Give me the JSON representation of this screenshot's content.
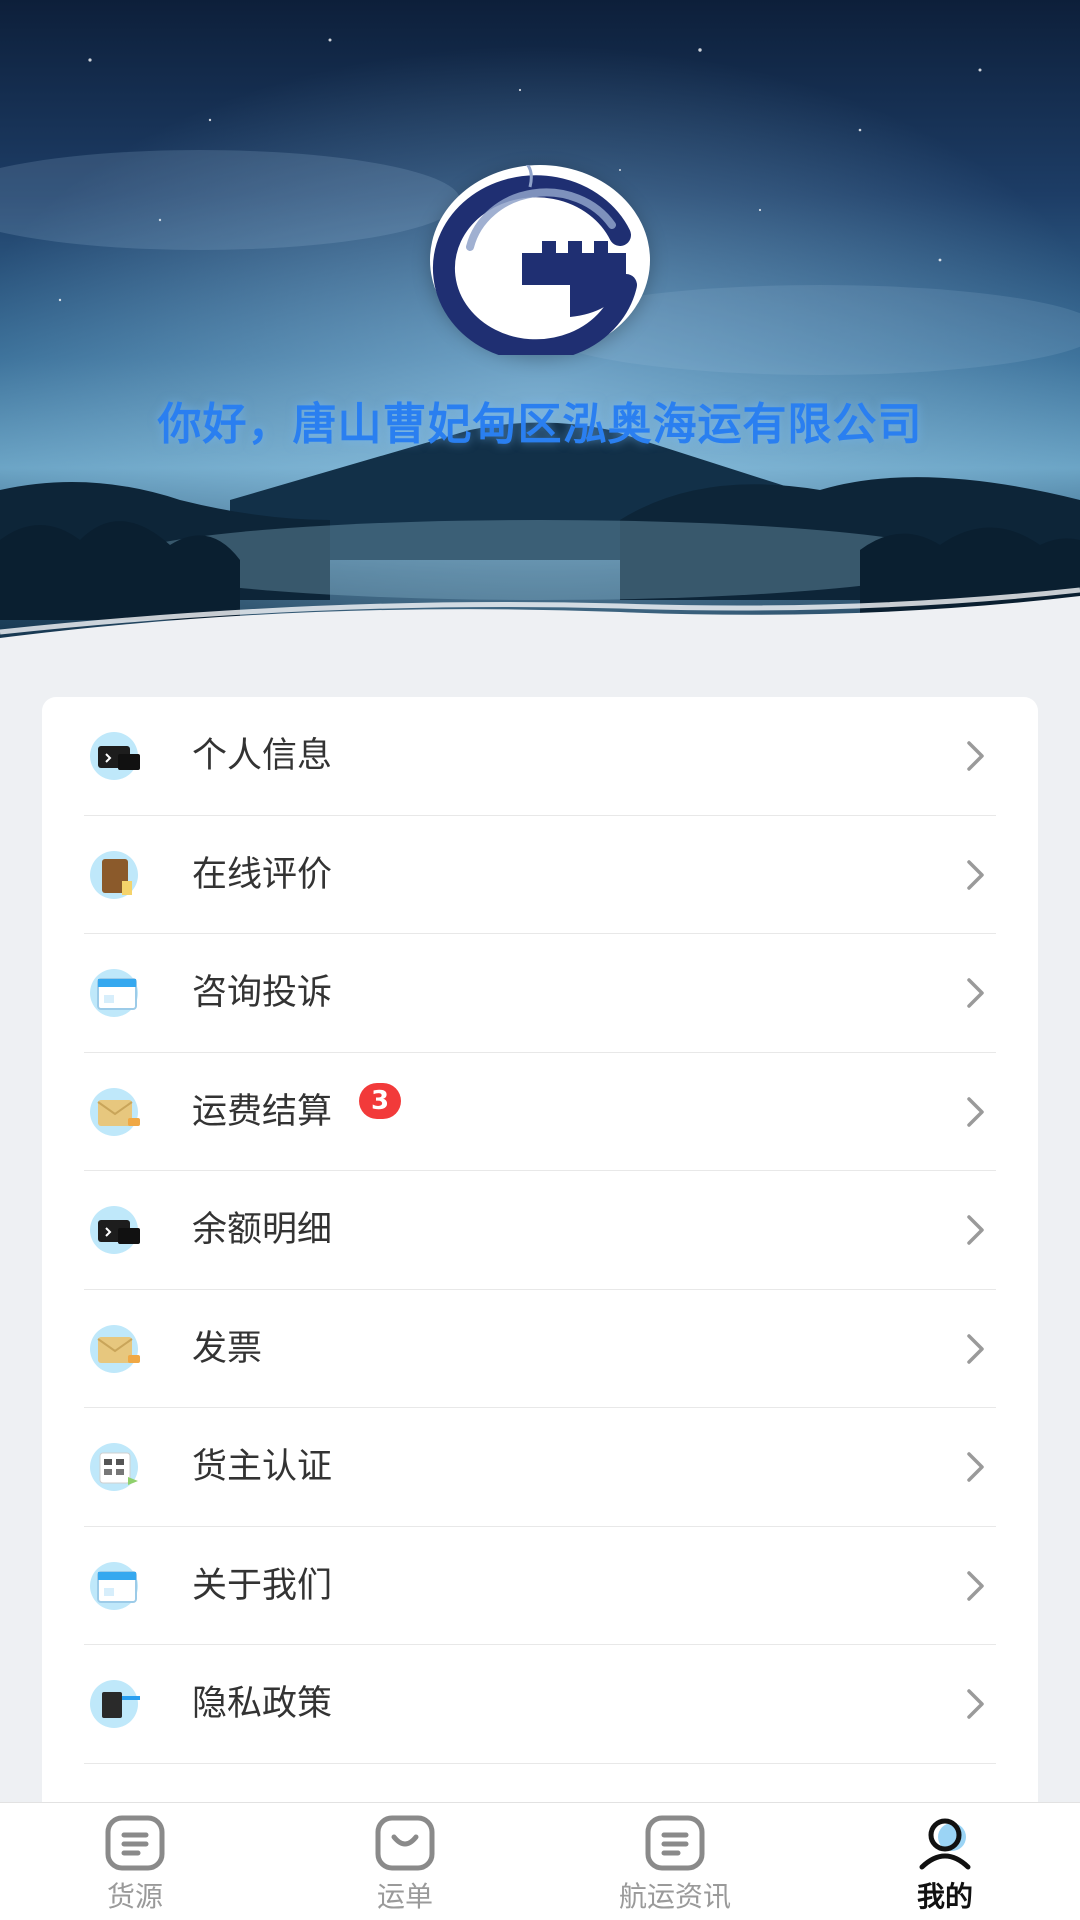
{
  "header": {
    "greeting": "你好，唐山曹妃甸区泓奥海运有限公司"
  },
  "menu": {
    "items": [
      {
        "label": "个人信息",
        "icon": "id-card-icon"
      },
      {
        "label": "在线评价",
        "icon": "notebook-icon"
      },
      {
        "label": "咨询投诉",
        "icon": "window-icon"
      },
      {
        "label": "运费结算",
        "icon": "envelope-icon",
        "badge": "3"
      },
      {
        "label": "余额明细",
        "icon": "id-card-icon"
      },
      {
        "label": "发票",
        "icon": "envelope-icon"
      },
      {
        "label": "货主认证",
        "icon": "calculator-icon"
      },
      {
        "label": "关于我们",
        "icon": "window-icon"
      },
      {
        "label": "隐私政策",
        "icon": "document-icon"
      }
    ]
  },
  "tabbar": {
    "tabs": [
      {
        "label": "货源",
        "icon": "list-icon"
      },
      {
        "label": "运单",
        "icon": "bag-icon"
      },
      {
        "label": "航运资讯",
        "icon": "list-icon"
      },
      {
        "label": "我的",
        "icon": "user-icon",
        "active": true
      }
    ]
  },
  "colors": {
    "accent_blue": "#2a7ff0",
    "badge_red": "#f23a3a",
    "icon_bg": "#bfe8fa"
  }
}
